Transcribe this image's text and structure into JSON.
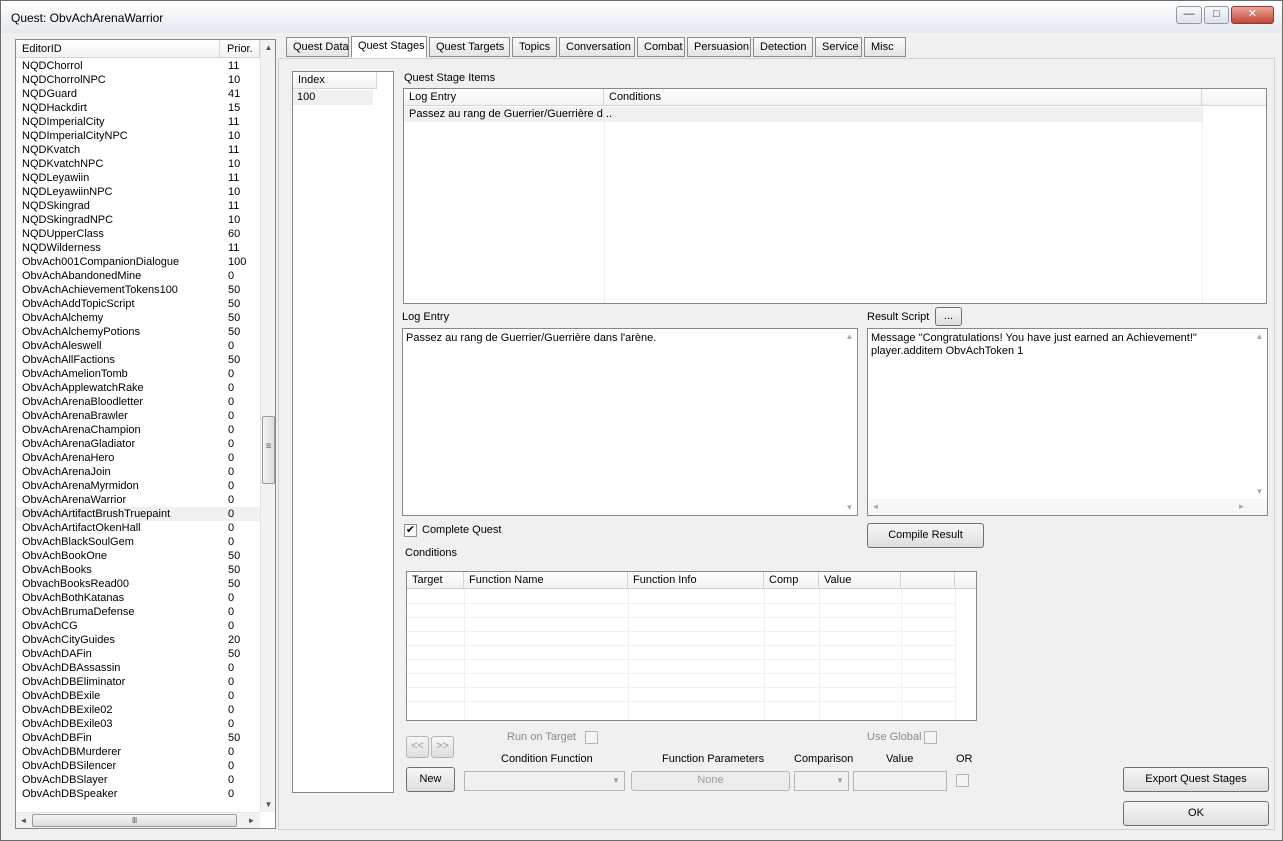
{
  "window": {
    "title": "Quest: ObvAchArenaWarrior",
    "minimize": "—",
    "maximize": "□",
    "close": "✕"
  },
  "editor_list": {
    "headers": {
      "editor_id": "EditorID",
      "priority": "Prior."
    },
    "selected_index": 32,
    "rows": [
      [
        "NQDChorrol",
        "11"
      ],
      [
        "NQDChorrolNPC",
        "10"
      ],
      [
        "NQDGuard",
        "41"
      ],
      [
        "NQDHackdirt",
        "15"
      ],
      [
        "NQDImperialCity",
        "11"
      ],
      [
        "NQDImperialCityNPC",
        "10"
      ],
      [
        "NQDKvatch",
        "11"
      ],
      [
        "NQDKvatchNPC",
        "10"
      ],
      [
        "NQDLeyawiin",
        "11"
      ],
      [
        "NQDLeyawiinNPC",
        "10"
      ],
      [
        "NQDSkingrad",
        "11"
      ],
      [
        "NQDSkingradNPC",
        "10"
      ],
      [
        "NQDUpperClass",
        "60"
      ],
      [
        "NQDWilderness",
        "11"
      ],
      [
        "ObvAch001CompanionDialogue",
        "100"
      ],
      [
        "ObvAchAbandonedMine",
        "0"
      ],
      [
        "ObvAchAchievementTokens100",
        "50"
      ],
      [
        "ObvAchAddTopicScript",
        "50"
      ],
      [
        "ObvAchAlchemy",
        "50"
      ],
      [
        "ObvAchAlchemyPotions",
        "50"
      ],
      [
        "ObvAchAleswell",
        "0"
      ],
      [
        "ObvAchAllFactions",
        "50"
      ],
      [
        "ObvAchAmelionTomb",
        "0"
      ],
      [
        "ObvAchApplewatchRake",
        "0"
      ],
      [
        "ObvAchArenaBloodletter",
        "0"
      ],
      [
        "ObvAchArenaBrawler",
        "0"
      ],
      [
        "ObvAchArenaChampion",
        "0"
      ],
      [
        "ObvAchArenaGladiator",
        "0"
      ],
      [
        "ObvAchArenaHero",
        "0"
      ],
      [
        "ObvAchArenaJoin",
        "0"
      ],
      [
        "ObvAchArenaMyrmidon",
        "0"
      ],
      [
        "ObvAchArenaWarrior",
        "0"
      ],
      [
        "ObvAchArtifactBrushTruepaint",
        "0"
      ],
      [
        "ObvAchArtifactOkenHall",
        "0"
      ],
      [
        "ObvAchBlackSoulGem",
        "0"
      ],
      [
        "ObvAchBookOne",
        "50"
      ],
      [
        "ObvAchBooks",
        "50"
      ],
      [
        "ObvachBooksRead00",
        "50"
      ],
      [
        "ObvAchBothKatanas",
        "0"
      ],
      [
        "ObvAchBrumaDefense",
        "0"
      ],
      [
        "ObvAchCG",
        "0"
      ],
      [
        "ObvAchCityGuides",
        "20"
      ],
      [
        "ObvAchDAFin",
        "50"
      ],
      [
        "ObvAchDBAssassin",
        "0"
      ],
      [
        "ObvAchDBEliminator",
        "0"
      ],
      [
        "ObvAchDBExile",
        "0"
      ],
      [
        "ObvAchDBExile02",
        "0"
      ],
      [
        "ObvAchDBExile03",
        "0"
      ],
      [
        "ObvAchDBFin",
        "50"
      ],
      [
        "ObvAchDBMurderer",
        "0"
      ],
      [
        "ObvAchDBSilencer",
        "0"
      ],
      [
        "ObvAchDBSlayer",
        "0"
      ],
      [
        "ObvAchDBSpeaker",
        "0"
      ]
    ]
  },
  "tabs": [
    "Quest Data",
    "Quest Stages",
    "Quest Targets",
    "Topics",
    "Conversation",
    "Combat",
    "Persuasion",
    "Detection",
    "Service",
    "Misc"
  ],
  "active_tab": "Quest Stages",
  "index_list": {
    "header": "Index",
    "rows": [
      "100"
    ]
  },
  "stage_items": {
    "label": "Quest Stage Items",
    "headers": {
      "log_entry": "Log Entry",
      "conditions": "Conditions"
    },
    "rows": [
      {
        "log_entry": "Passez au rang de Guerrier/Guerrière d...",
        "conditions": ""
      }
    ]
  },
  "log_entry": {
    "label": "Log Entry",
    "text": "Passez au rang de Guerrier/Guerrière dans l'arène."
  },
  "result_script": {
    "label": "Result Script",
    "browse": "...",
    "text": "Message \"Congratulations! You have just earned an Achievement!\"\nplayer.additem ObvAchToken 1",
    "compile_label": "Compile Result"
  },
  "complete_quest": {
    "label": "Complete Quest",
    "checked": true,
    "mark": "✔"
  },
  "conditions": {
    "label": "Conditions",
    "headers": {
      "target": "Target",
      "function_name": "Function Name",
      "function_info": "Function Info",
      "comp": "Comp",
      "value": "Value"
    }
  },
  "condition_editor": {
    "prev": "<<",
    "next": ">>",
    "new_label": "New",
    "run_on_target": "Run on Target",
    "use_global": "Use Global",
    "condition_function": "Condition Function",
    "function_parameters": "Function Parameters",
    "parameters_value": "None",
    "comparison": "Comparison",
    "value": "Value",
    "or": "OR"
  },
  "buttons": {
    "export": "Export Quest Stages",
    "ok": "OK"
  },
  "scroll_icons": {
    "up": "▲",
    "down": "▼",
    "left": "◄",
    "right": "►",
    "grip": "≡",
    "hgrip": "Ⅲ",
    "dropdown": "▼"
  }
}
